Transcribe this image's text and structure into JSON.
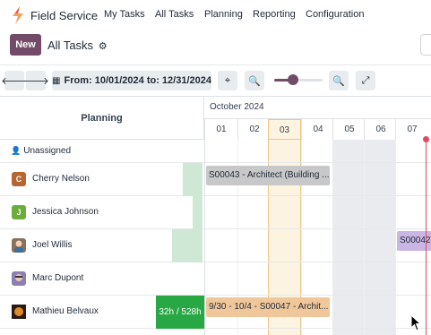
{
  "app": {
    "name": "Field Service"
  },
  "nav": {
    "items": [
      "My Tasks",
      "All Tasks",
      "Planning",
      "Reporting",
      "Configuration"
    ]
  },
  "control": {
    "new_label": "New",
    "breadcrumb": "All Tasks"
  },
  "toolbar": {
    "date_range": "From: 10/01/2024 to: 12/31/2024",
    "zoom_level": 0.35
  },
  "gantt": {
    "row_header": "Planning",
    "month": "October 2024",
    "days": [
      "01",
      "02",
      "03",
      "04",
      "05",
      "06",
      "07"
    ],
    "today": "03",
    "weekend_days": [
      "05",
      "06"
    ],
    "unassigned_label": "Unassigned",
    "resources": [
      {
        "name": "Cherry Nelson",
        "initial": "C",
        "color": "#b9652f"
      },
      {
        "name": "Jessica Johnson",
        "initial": "J",
        "color": "#6aad3a"
      },
      {
        "name": "Joel Willis",
        "initial": "",
        "color": "#8a6f5a"
      },
      {
        "name": "Marc Dupont",
        "initial": "",
        "color": "#8c7fb5"
      },
      {
        "name": "Mathieu Belvaux",
        "initial": "",
        "color": "#6b3a1e"
      }
    ],
    "pills": [
      {
        "label": "S00043 - Architect (Building ...",
        "color": "#c8c8c8"
      },
      {
        "label": "S00042",
        "color": "#c9b6e4"
      },
      {
        "label": "9/30 - 10/4 - S00047 - Archit...",
        "color": "#f0c79b"
      }
    ],
    "hours_badge": "32h / 528h"
  },
  "colors": {
    "brand": "#714B67",
    "today": "#fdf3e1",
    "weekend": "#e9ecef",
    "now_line": "#e04a5c",
    "badge": "#28a745"
  }
}
